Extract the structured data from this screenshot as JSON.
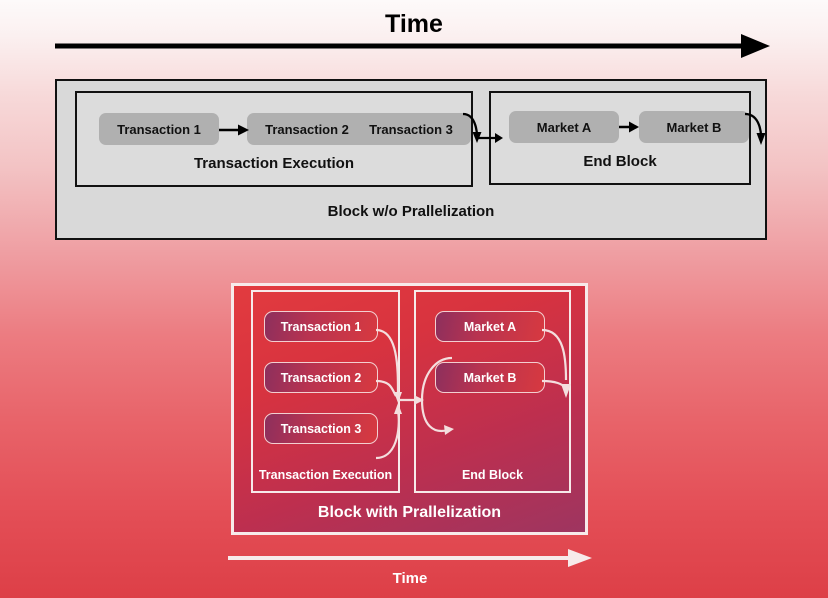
{
  "top_section": {
    "time_title": "Time",
    "time_arrow_icon": "arrow-right-icon",
    "block_label": "Block w/o Prallelization",
    "execution_panel": {
      "label": "Transaction Execution",
      "chips": [
        "Transaction 1",
        "Transaction 2",
        "Transaction 3"
      ]
    },
    "end_block_panel": {
      "label": "End Block",
      "chips": [
        "Market A",
        "Market B"
      ]
    },
    "colors": {
      "outer_fill": "#d9d9d9",
      "inner_fill": "#dcdcdc",
      "chip_fill": "#b0b0b0",
      "stroke": "#111111",
      "text": "#111111"
    }
  },
  "bottom_section": {
    "block_label": "Block with Prallelization",
    "execution_panel": {
      "label": "Transaction Execution",
      "chips": [
        "Transaction 1",
        "Transaction 2",
        "Transaction 3"
      ]
    },
    "end_block_panel": {
      "label": "End Block",
      "chips": [
        "Market A",
        "Market B"
      ]
    },
    "time_label": "Time",
    "time_arrow_icon": "arrow-right-icon",
    "colors": {
      "panel_gradient_start": "#e23b3f",
      "panel_gradient_end": "#9e3560",
      "chip_gradient_start": "#8d2f5d",
      "chip_gradient_end": "#d73940",
      "stroke": "#f7eaea",
      "text": "#ffffff"
    }
  },
  "background": {
    "gradient_top": "#fdfafa",
    "gradient_bottom": "#dd3f47"
  }
}
